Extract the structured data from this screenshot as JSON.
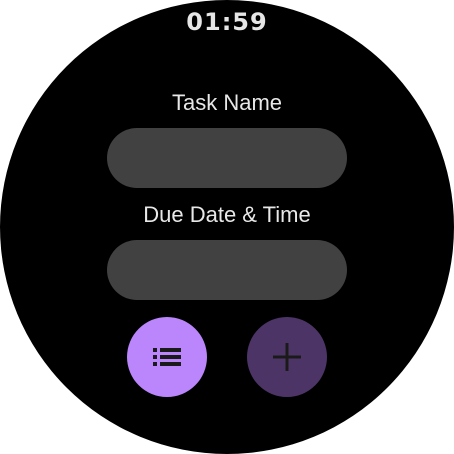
{
  "status": {
    "time": "01:59"
  },
  "form": {
    "task_name": {
      "label": "Task Name",
      "value": ""
    },
    "due_date_time": {
      "label": "Due Date & Time",
      "value": ""
    }
  },
  "actions": {
    "list_button": {
      "icon": "list-icon",
      "color": "#bb86fc"
    },
    "add_button": {
      "icon": "plus-icon",
      "color": "#4c3566"
    }
  }
}
